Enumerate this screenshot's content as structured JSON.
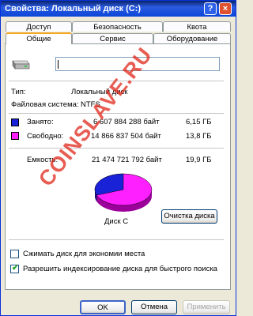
{
  "window": {
    "title": "Свойства: Локальный диск (C:)"
  },
  "titlebar": {
    "help_glyph": "?",
    "close_glyph": "×"
  },
  "tabs": {
    "row1": [
      {
        "label": "Доступ"
      },
      {
        "label": "Безопасность"
      },
      {
        "label": "Квота"
      }
    ],
    "row2": [
      {
        "label": "Общие",
        "active": true
      },
      {
        "label": "Сервис"
      },
      {
        "label": "Оборудование"
      }
    ]
  },
  "general": {
    "drive_name_value": "",
    "type_label": "Тип:",
    "type_value": "Локальный диск",
    "fs_label": "Файловая система:",
    "fs_value": "NTFS",
    "used": {
      "label": "Занято:",
      "bytes": "6 607 884 288 байт",
      "size": "6,15 ГБ",
      "color": "#1a22d8"
    },
    "free": {
      "label": "Свободно:",
      "bytes": "14 866 837 504 байт",
      "size": "13,8 ГБ",
      "color": "#ff20ff"
    },
    "capacity": {
      "label": "Емкость:",
      "bytes": "21 474 721 792 байт",
      "size": "19,9 ГБ"
    },
    "disk_label": "Диск C",
    "cleanup_button": "Очистка диска",
    "compress_checkbox": {
      "label": "Сжимать диск для экономии места",
      "checked": false
    },
    "index_checkbox": {
      "label": "Разрешить индексирование диска для быстрого поиска",
      "checked": true
    }
  },
  "chart_data": {
    "type": "pie",
    "categories": [
      "Занято",
      "Свободно"
    ],
    "values": [
      6607884288,
      14866837504
    ],
    "colors": [
      "#1a22d8",
      "#ff20ff"
    ]
  },
  "buttons": {
    "ok": "OK",
    "cancel": "Отмена",
    "apply": "Применить"
  },
  "watermark": "COINSLAVE.RU"
}
